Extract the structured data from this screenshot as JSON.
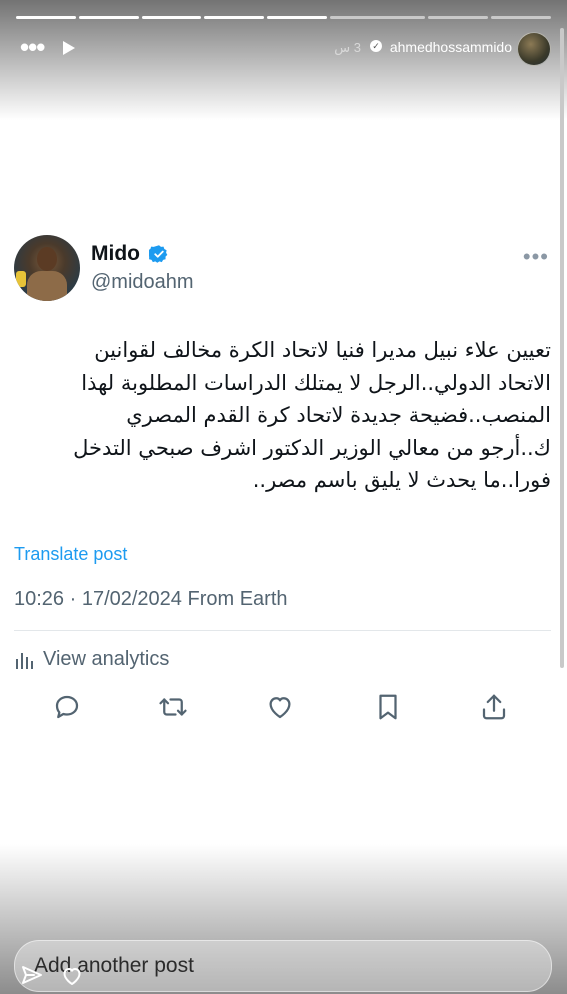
{
  "story": {
    "username": "ahmedhossammido",
    "time_ago": "3 س",
    "reply_placeholder": "Add another post"
  },
  "tweet": {
    "display_name": "Mido",
    "handle": "@midoahm",
    "text": "تعيين علاء نبيل مديرا فنيا لاتحاد الكرة مخالف لقوانين\nالاتحاد الدولي..الرجل لا يمتلك الدراسات المطلوبة لهذا\nالمنصب..فضيحة جديدة لاتحاد كرة القدم المصري\nك..أرجو من معالي الوزير الدكتور اشرف صبحي التدخل\nفورا..ما يحدث لا يليق باسم مصر..",
    "translate_label": "Translate post",
    "meta": "10:26 · 17/02/2024 From Earth",
    "analytics_label": "View analytics"
  },
  "colors": {
    "link": "#1d9bf0",
    "verified": "#1d9bf0",
    "secondary_text": "#536471",
    "primary_text": "#0f1419"
  },
  "icons": {
    "header": [
      "more-horizontal-icon",
      "play-icon",
      "verified-icon"
    ],
    "actions": [
      "reply-icon",
      "repost-icon",
      "like-icon",
      "bookmark-icon",
      "share-icon"
    ],
    "bottom": [
      "send-icon",
      "heart-icon"
    ]
  }
}
